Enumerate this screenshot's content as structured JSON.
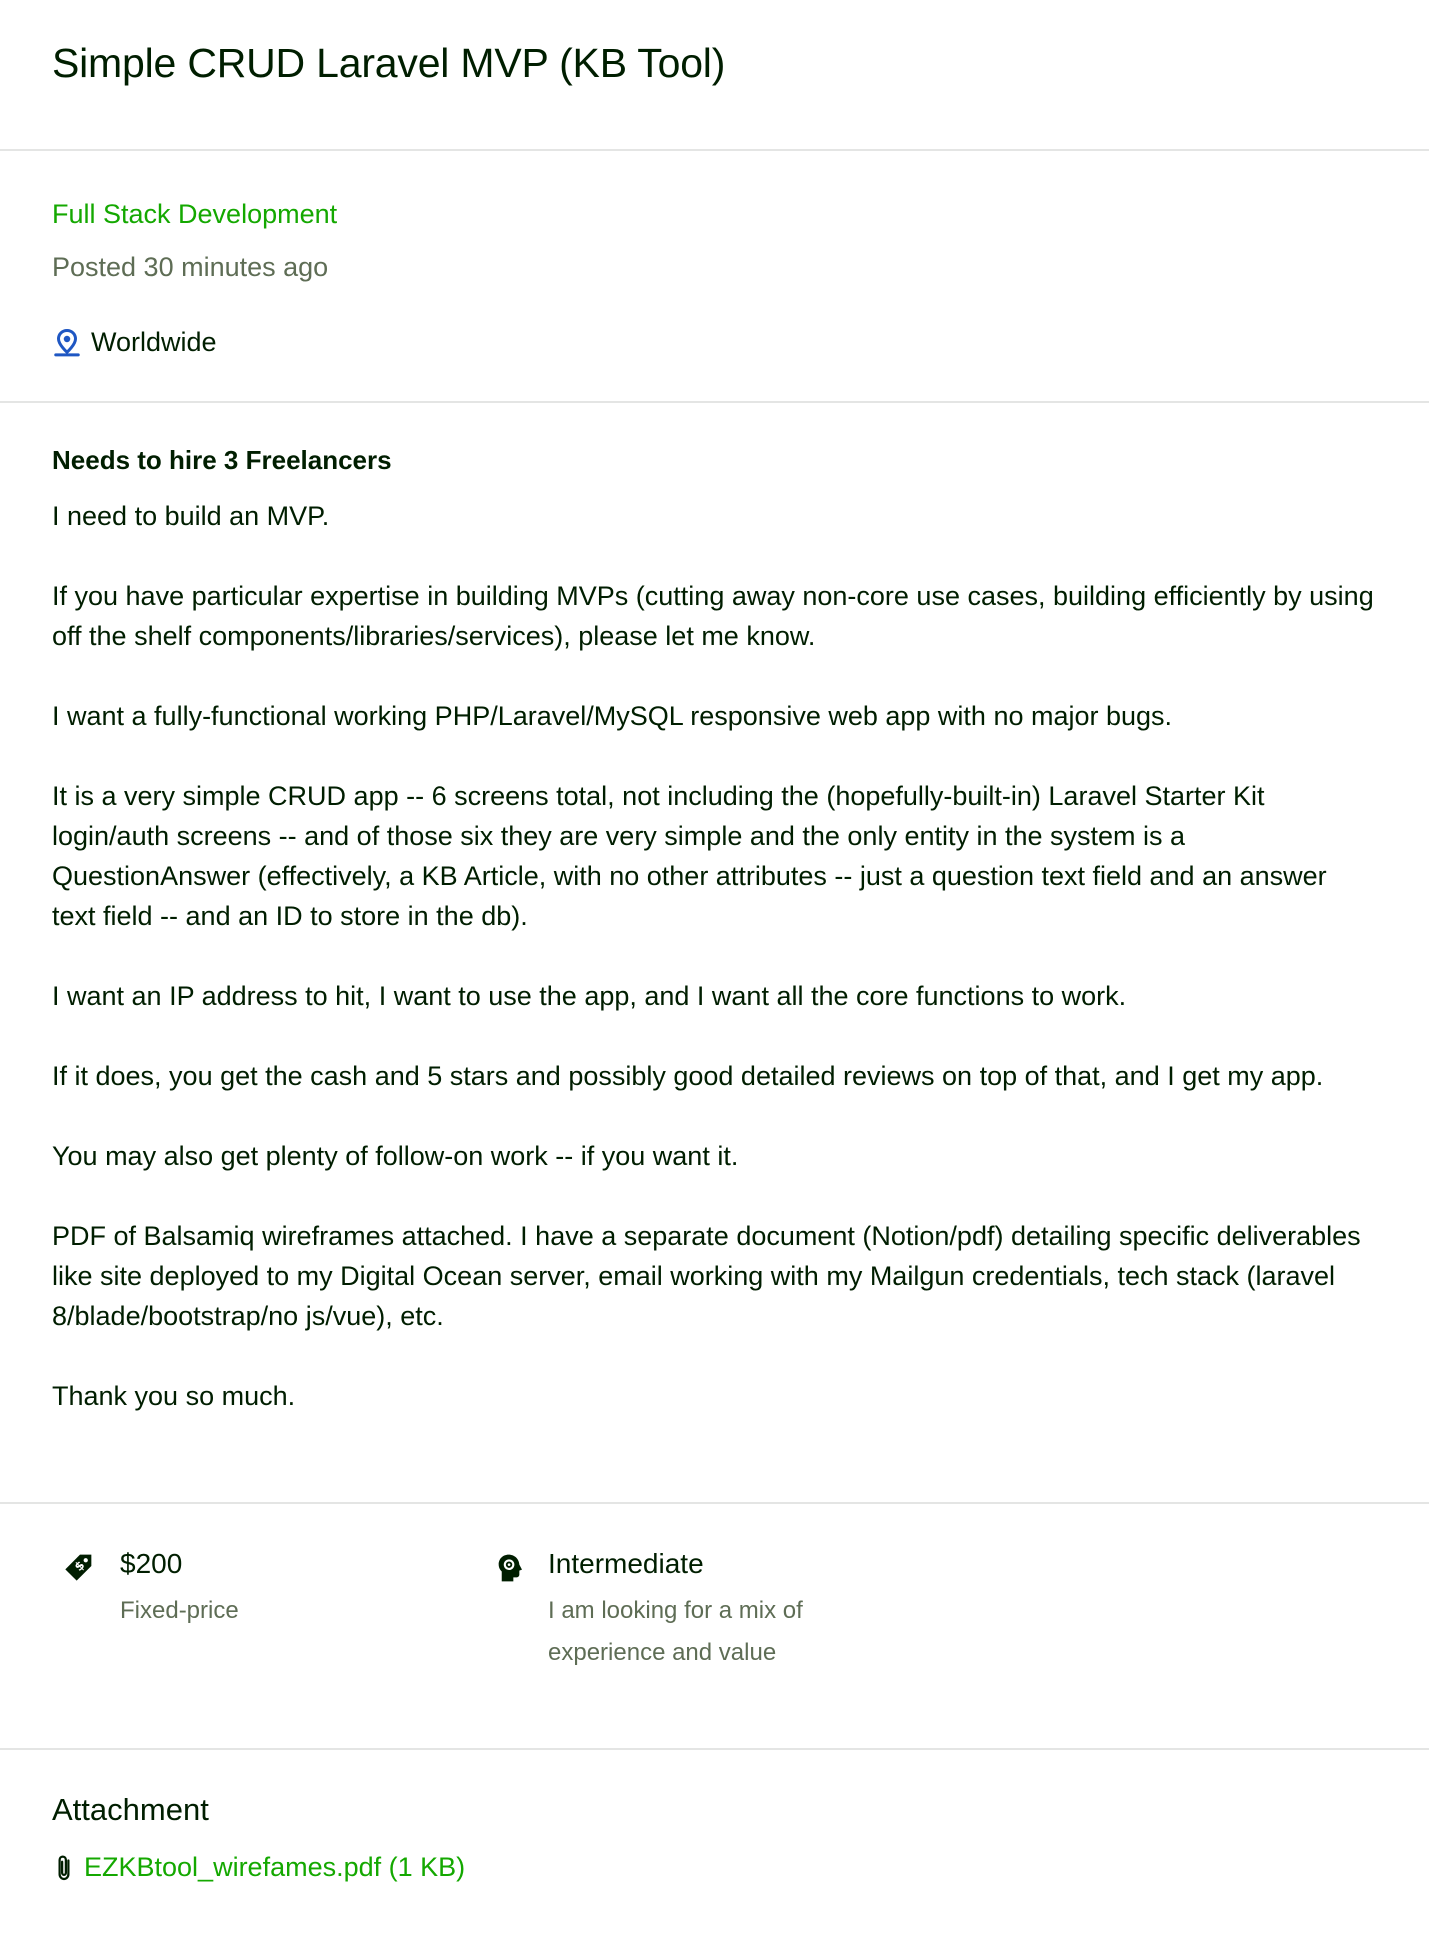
{
  "job": {
    "title": "Simple CRUD Laravel MVP (KB Tool)",
    "category": "Full Stack Development",
    "posted": "Posted 30 minutes ago",
    "location": "Worldwide",
    "hire_note": "Needs to hire 3 Freelancers",
    "description": [
      "I need to build an MVP.",
      "If you have particular expertise in building MVPs (cutting away non-core use cases, building efficiently by using off the shelf components/libraries/services), please let me know.",
      "I want a fully-functional working PHP/Laravel/MySQL responsive web app with no major bugs.",
      "It is a very simple CRUD app -- 6 screens total, not including the (hopefully-built-in) Laravel Starter Kit login/auth screens -- and of those six they are very simple and the only entity in the system is a QuestionAnswer (effectively, a KB Article, with no other attributes -- just a question text field and an answer text field -- and an ID to store in the db).",
      "I want an IP address to hit, I want to use the app, and I want all the core functions to work.",
      "If it does, you get the cash and 5 stars and possibly good detailed reviews on top of that, and I get my app.",
      "You may also get plenty of follow-on work -- if you want it.",
      "PDF of Balsamiq wireframes attached. I have a separate document (Notion/pdf) detailing specific deliverables like site deployed to my Digital Ocean server, email working with my Mailgun credentials, tech stack (laravel 8/blade/bootstrap/no js/vue), etc.",
      "Thank you so much."
    ],
    "price": {
      "value": "$200",
      "type": "Fixed-price",
      "icon": "price-tag-icon"
    },
    "level": {
      "value": "Intermediate",
      "description": "I am looking for a mix of experience and value",
      "icon": "expertise-head-icon"
    },
    "attachment": {
      "heading": "Attachment",
      "file_label": "EZKBtool_wirefames.pdf (1 KB)",
      "icon": "paperclip-icon"
    }
  },
  "colors": {
    "accent": "#14a800",
    "text": "#001e00",
    "muted": "#5e6d55",
    "divider": "#e4e5e4",
    "location_icon": "#1f57c3"
  }
}
